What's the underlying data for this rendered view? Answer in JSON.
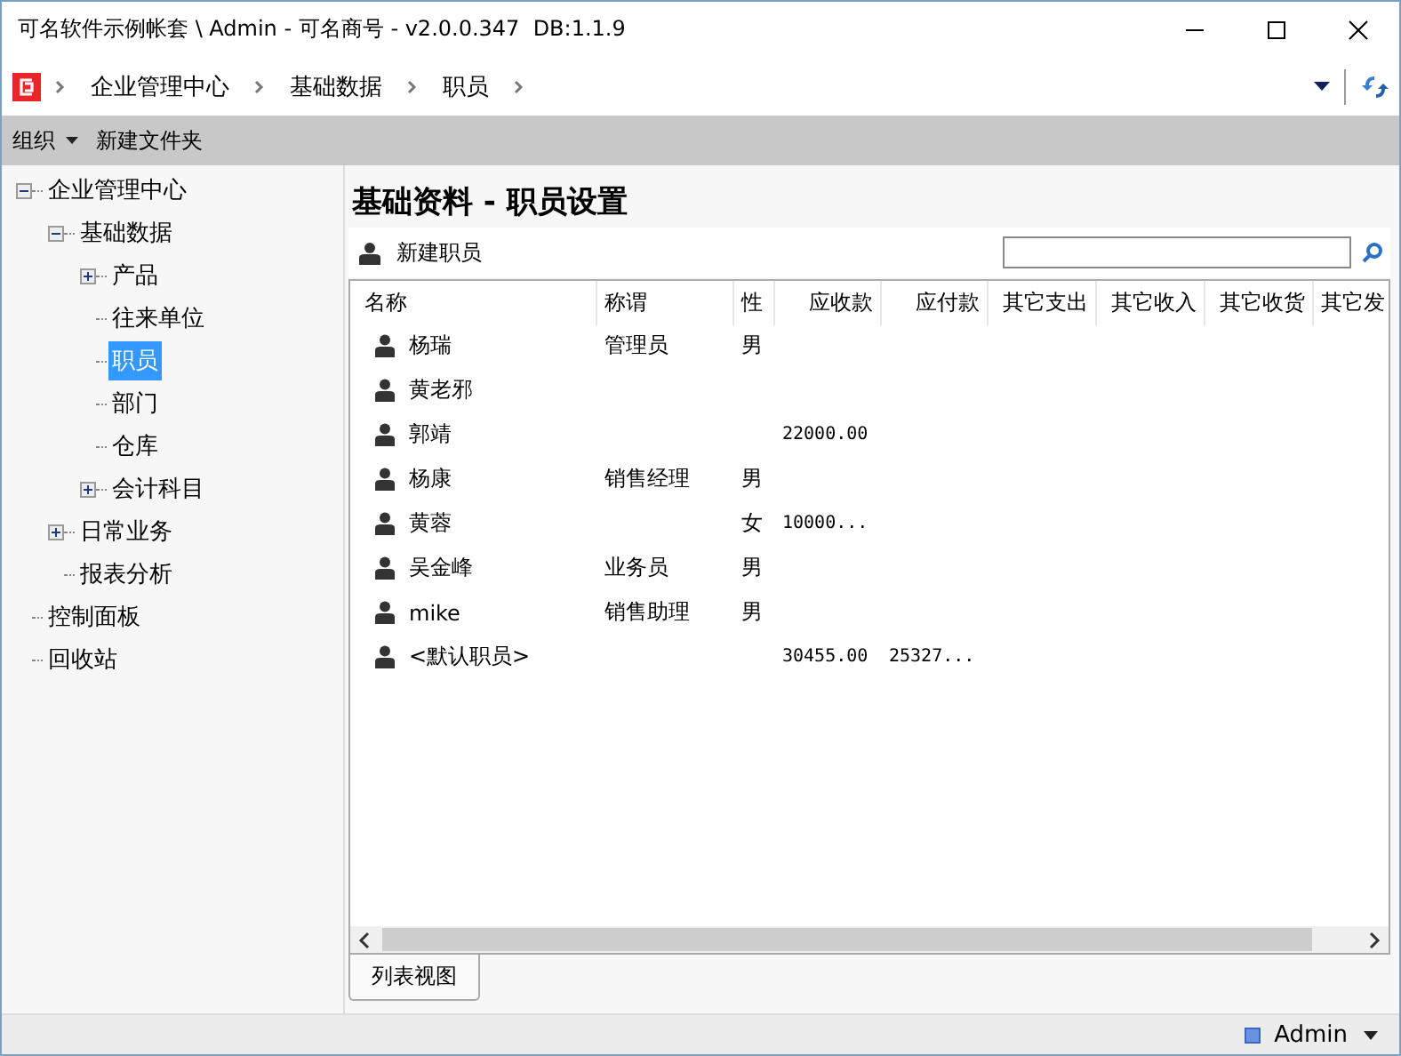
{
  "window": {
    "title": "可名软件示例帐套 \\ Admin - 可名商号 - v2.0.0.347  DB:1.1.9"
  },
  "breadcrumb": [
    "企业管理中心",
    "基础数据",
    "职员"
  ],
  "toolbar": {
    "organize": "组织",
    "new_folder": "新建文件夹"
  },
  "tree": [
    {
      "label": "企业管理中心",
      "expanded": true,
      "selected": false,
      "children": [
        {
          "label": "基础数据",
          "expanded": true,
          "selected": false,
          "children": [
            {
              "label": "产品",
              "expanded": false,
              "selected": false
            },
            {
              "label": "往来单位",
              "selected": false
            },
            {
              "label": "职员",
              "selected": true
            },
            {
              "label": "部门",
              "selected": false
            },
            {
              "label": "仓库",
              "selected": false
            },
            {
              "label": "会计科目",
              "expanded": false,
              "selected": false
            }
          ]
        },
        {
          "label": "日常业务",
          "expanded": false,
          "selected": false
        },
        {
          "label": "报表分析",
          "selected": false
        }
      ]
    },
    {
      "label": "控制面板",
      "selected": false
    },
    {
      "label": "回收站",
      "selected": false
    }
  ],
  "content": {
    "heading": "基础资料 - 职员设置",
    "new_button": "新建职员"
  },
  "table": {
    "columns": [
      "名称",
      "称谓",
      "性",
      "应收款",
      "应付款",
      "其它支出",
      "其它收入",
      "其它收货",
      "其它发"
    ],
    "rows": [
      {
        "name": "杨瑞",
        "title": "管理员",
        "gender": "男"
      },
      {
        "name": "黄老邪"
      },
      {
        "name": "郭靖",
        "receivable": "22000.00"
      },
      {
        "name": "杨康",
        "title": "销售经理",
        "gender": "男"
      },
      {
        "name": "黄蓉",
        "gender": "女",
        "receivable": "10000..."
      },
      {
        "name": "吴金峰",
        "title": "业务员",
        "gender": "男"
      },
      {
        "name": "mike",
        "title": "销售助理",
        "gender": "男"
      },
      {
        "name": "<默认职员>",
        "receivable": "30455.00",
        "payable": "25327..."
      }
    ]
  },
  "view_tabs": [
    {
      "label": "列表视图",
      "selected": true
    }
  ],
  "status_bar": {
    "user": "Admin"
  }
}
